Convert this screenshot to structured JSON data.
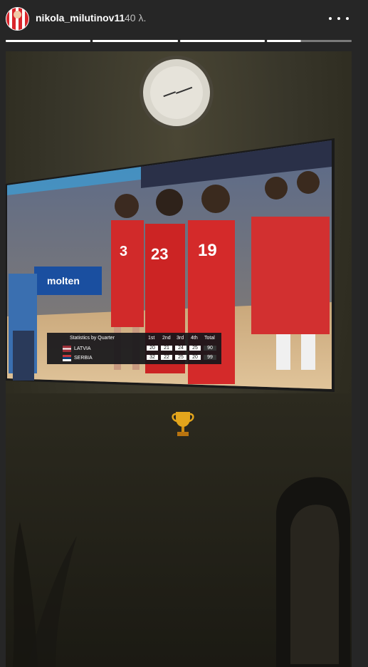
{
  "header": {
    "username": "nikola_milutinov11",
    "time": "40 λ.",
    "more_icon": "more-horizontal-icon",
    "progress": {
      "segments": 4,
      "completed": 3,
      "current_fraction": 0.4
    }
  },
  "scoreboard": {
    "title": "Statistics by Quarter",
    "columns": [
      "1st",
      "2nd",
      "3rd",
      "4th",
      "Total"
    ],
    "rows": [
      {
        "team": "LATVIA",
        "scores": [
          "20",
          "21",
          "24",
          "25"
        ],
        "total": "90"
      },
      {
        "team": "SERBIA",
        "scores": [
          "32",
          "22",
          "25",
          "20"
        ],
        "total": "99"
      }
    ]
  },
  "jerseys": {
    "left": "3",
    "middle": "23",
    "right": "19"
  },
  "sticker": "trophy-icon"
}
